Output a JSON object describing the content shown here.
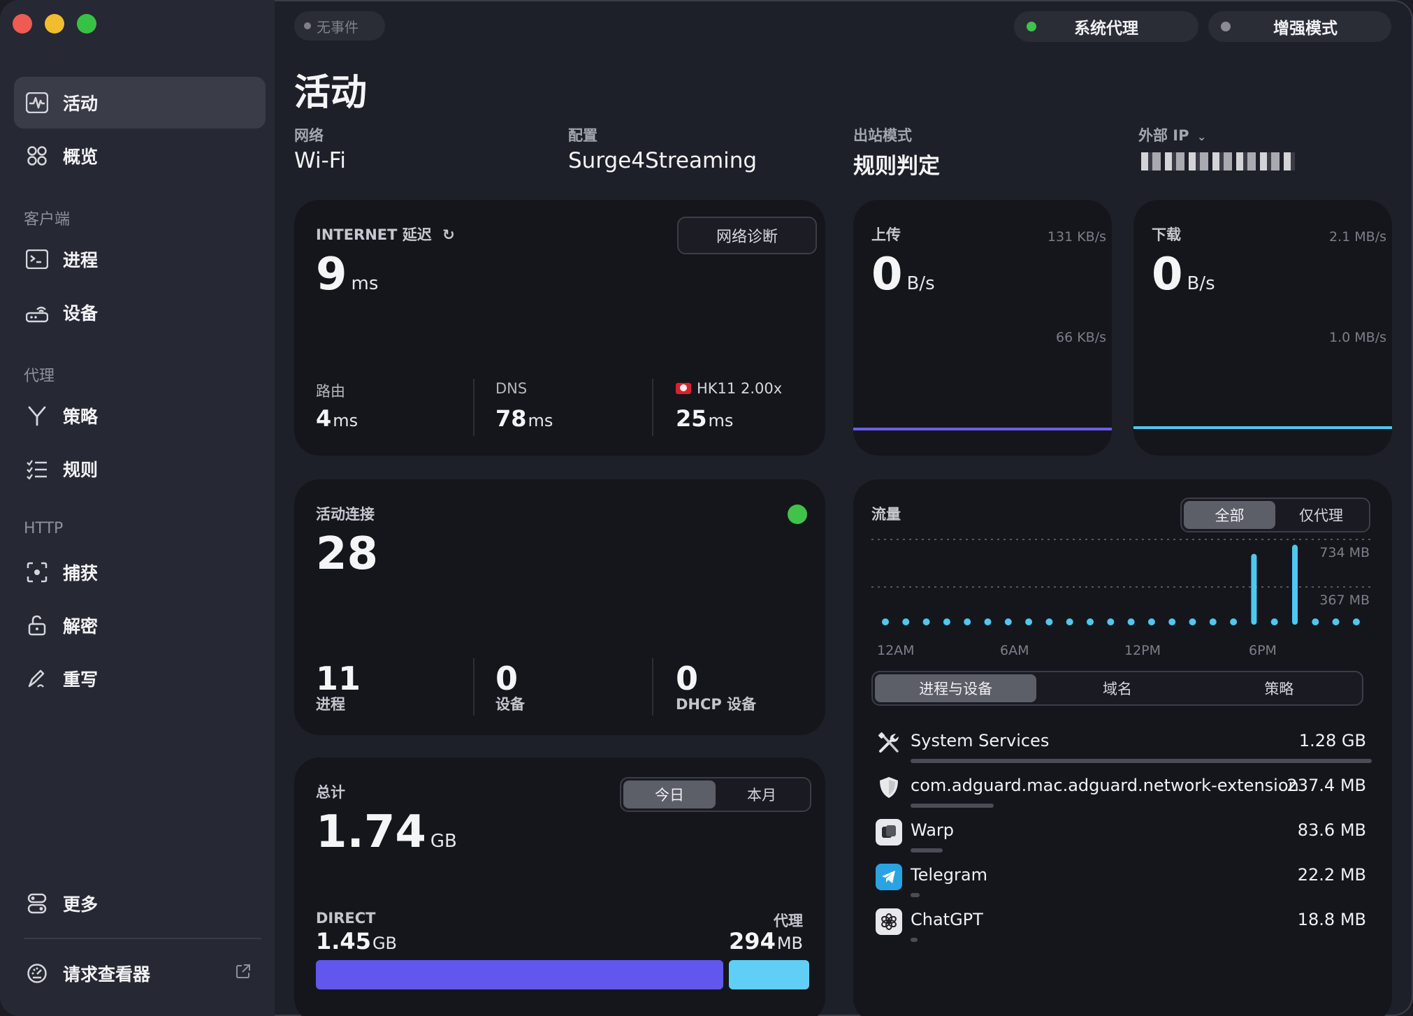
{
  "sidebar": {
    "items": [
      {
        "label": "活动",
        "icon": "activity-icon"
      },
      {
        "label": "概览",
        "icon": "grid-icon"
      },
      {
        "label": "进程",
        "icon": "terminal-icon"
      },
      {
        "label": "设备",
        "icon": "router-icon"
      },
      {
        "label": "策略",
        "icon": "branch-icon"
      },
      {
        "label": "规则",
        "icon": "checklist-icon"
      },
      {
        "label": "捕获",
        "icon": "capture-icon"
      },
      {
        "label": "解密",
        "icon": "unlock-icon"
      },
      {
        "label": "重写",
        "icon": "pen-icon"
      },
      {
        "label": "更多",
        "icon": "toggles-icon"
      },
      {
        "label": "请求查看器",
        "icon": "gauge-icon"
      }
    ],
    "sections": [
      "客户端",
      "代理",
      "HTTP"
    ]
  },
  "topbar": {
    "event_pill": "无事件",
    "system_proxy": "系统代理",
    "enhanced_mode": "增强模式",
    "colors": {
      "system_proxy_dot": "#3fc34b",
      "enhanced_mode_dot": "#8a8b92"
    }
  },
  "header": {
    "title": "活动",
    "network_label": "网络",
    "network_value": "Wi-Fi",
    "profile_label": "配置",
    "profile_value": "Surge4Streaming",
    "outbound_label": "出站模式",
    "outbound_value": "规则判定",
    "external_ip_label": "外部 IP"
  },
  "latency": {
    "label": "INTERNET 延迟",
    "value": "9",
    "unit": "ms",
    "diagnose_button": "网络诊断",
    "router_label": "路由",
    "router_value": "4",
    "dns_label": "DNS",
    "dns_value": "78",
    "node_label": "HK11 2.00x",
    "node_value": "25",
    "ms": "ms"
  },
  "upload": {
    "label": "上传",
    "value": "0",
    "unit": "B/s",
    "scale_top": "131 KB/s",
    "scale_mid": "66 KB/s",
    "line_color": "#6c5cf0"
  },
  "download": {
    "label": "下载",
    "value": "0",
    "unit": "B/s",
    "scale_top": "2.1 MB/s",
    "scale_mid": "1.0 MB/s",
    "line_color": "#4fc7ef"
  },
  "connections": {
    "label": "活动连接",
    "value": "28",
    "processes_value": "11",
    "processes_label": "进程",
    "devices_value": "0",
    "devices_label": "设备",
    "dhcp_value": "0",
    "dhcp_label": "DHCP 设备",
    "status_color": "#3fc34b"
  },
  "total": {
    "label": "总计",
    "value": "1.74",
    "unit": "GB",
    "seg_today": "今日",
    "seg_month": "本月",
    "direct_label": "DIRECT",
    "direct_value": "1.45",
    "direct_unit": "GB",
    "proxy_label": "代理",
    "proxy_value": "294",
    "proxy_unit": "MB",
    "direct_fraction": 0.835,
    "colors": {
      "direct": "#6157ef",
      "proxy": "#61cff5"
    }
  },
  "traffic": {
    "label": "流量",
    "seg_all": "全部",
    "seg_proxy": "仅代理",
    "tabs": [
      "进程与设备",
      "域名",
      "策略"
    ],
    "chart_data": {
      "type": "bar",
      "y_ticks": [
        "734 MB",
        "367 MB"
      ],
      "x_ticks": [
        "12AM",
        "6AM",
        "12PM",
        "6PM"
      ],
      "ylim_mb": [
        0,
        734
      ],
      "values_mb": [
        2,
        2,
        2,
        2,
        40,
        2,
        2,
        2,
        2,
        2,
        2,
        2,
        2,
        2,
        2,
        2,
        2,
        2,
        620,
        2,
        700,
        25,
        2,
        2
      ]
    },
    "processes": [
      {
        "name": "System Services",
        "size": "1.28 GB",
        "icon": "tools-icon",
        "fraction": 1.0
      },
      {
        "name": "com.adguard.mac.adguard.network-extension",
        "size": "237.4 MB",
        "icon": "shield-icon",
        "fraction": 0.18
      },
      {
        "name": "Warp",
        "size": "83.6 MB",
        "icon": "warp-icon",
        "fraction": 0.07
      },
      {
        "name": "Telegram",
        "size": "22.2 MB",
        "icon": "telegram-icon",
        "fraction": 0.02
      },
      {
        "name": "ChatGPT",
        "size": "18.8 MB",
        "icon": "chatgpt-icon",
        "fraction": 0.015
      }
    ]
  }
}
